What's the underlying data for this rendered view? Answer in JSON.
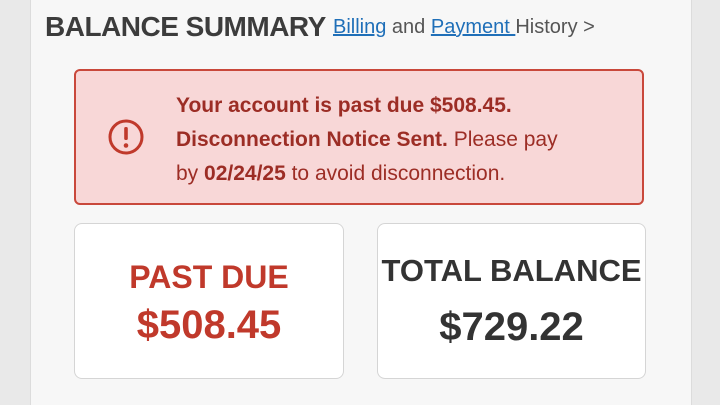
{
  "header": {
    "title": "BALANCE SUMMARY",
    "billing_link": "Billing",
    "and_text": "and",
    "payment_link": "Payment ",
    "history_text": "History",
    "arrow": ">"
  },
  "alert": {
    "icon": "exclamation-circle-icon",
    "line1": "Your account is past due $508.45.",
    "notice_bold": "Disconnection Notice Sent.",
    "notice_rest": " Please pay",
    "by_text": "by ",
    "due_date": "02/24/25",
    "after_date": " to avoid disconnection."
  },
  "past_due": {
    "label": "PAST DUE",
    "amount": "$508.45"
  },
  "total_balance": {
    "label": "TOTAL BALANCE",
    "amount": "$729.22"
  },
  "colors": {
    "alert_bg": "#f8d7d7",
    "alert_border": "#c9483b",
    "alert_text": "#9c2d25",
    "past_due_red": "#c0392b",
    "link_blue": "#1f6fb8"
  }
}
